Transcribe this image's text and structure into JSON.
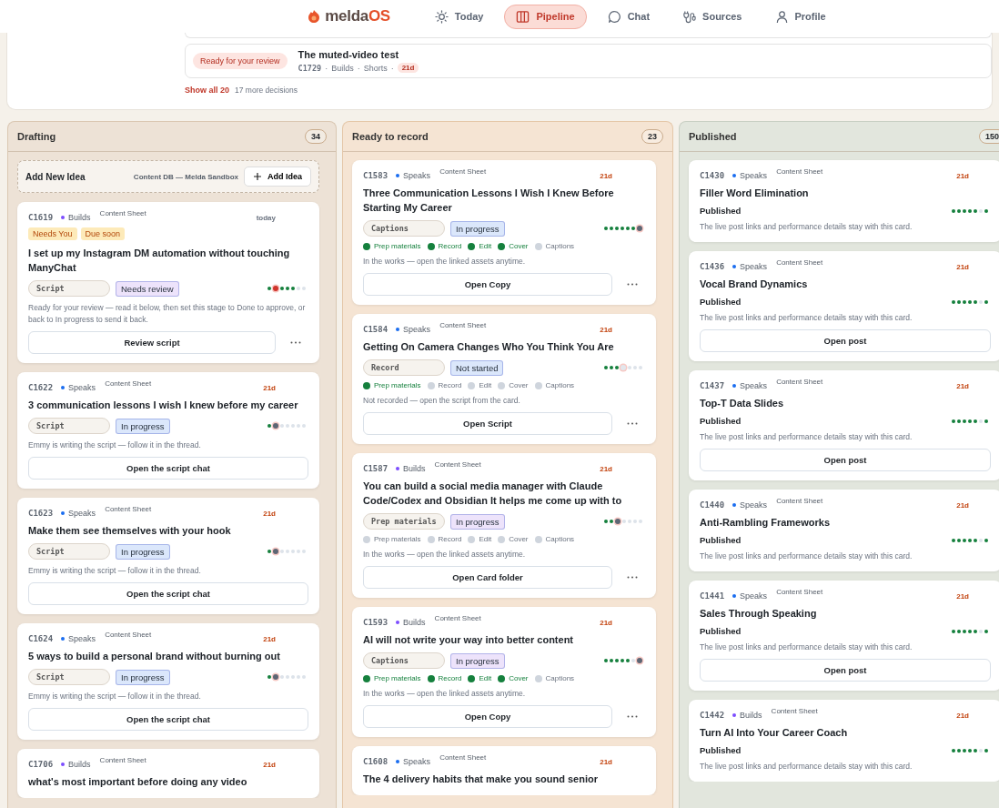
{
  "nav": {
    "logo": {
      "name": "melda",
      "suffix": "OS"
    },
    "items": [
      {
        "label": "Today",
        "selected": false
      },
      {
        "label": "Pipeline",
        "selected": true
      },
      {
        "label": "Chat",
        "selected": false
      },
      {
        "label": "Sources",
        "selected": false
      },
      {
        "label": "Profile",
        "selected": false
      }
    ]
  },
  "decisions": {
    "items": [
      {
        "badge": "Ready for your review",
        "title": "The muted-video test",
        "code": "C1729",
        "separator": "·",
        "meta": [
          "Builds",
          "Shorts"
        ],
        "age": "21d"
      }
    ],
    "show_all": "Show all 20",
    "more": "17 more decisions"
  },
  "columns": [
    {
      "title": "Drafting",
      "count": "34",
      "add_idea": {
        "title": "Add New Idea",
        "source": "Content DB — Melda Sandbox",
        "button": "Add Idea"
      },
      "cards": [
        {
          "code": "C1619",
          "category": "Builds",
          "color": "#7c4dff",
          "sheet": "Content Sheet",
          "age": "today",
          "overdue": false,
          "tags": [
            "Needs You",
            "Due soon"
          ],
          "title": "I set up my Instagram DM automation without touching ManyChat",
          "stage": "Script",
          "status": {
            "text": "Needs review",
            "color": "#ede3fb"
          },
          "dots": [
            {
              "kind": "done"
            },
            {
              "kind": "alert"
            },
            {
              "kind": "done"
            },
            {
              "kind": "done"
            },
            {
              "kind": "done"
            },
            {
              "kind": "todo"
            },
            {
              "kind": "todo"
            }
          ],
          "note": "Ready for your review — read it below, then set this stage to Done to approve, or back to In progress to send it back.",
          "action": "Review script",
          "menu": true
        },
        {
          "code": "C1622",
          "category": "Speaks",
          "color": "#1a6df0",
          "sheet": "Content Sheet",
          "age": "21d",
          "overdue": true,
          "title": "3 communication lessons I wish I knew before my career",
          "stage": "Script",
          "status": {
            "text": "In progress",
            "color": "#dbe7fb"
          },
          "dots": [
            {
              "kind": "done"
            },
            {
              "kind": "current"
            },
            {
              "kind": "todo"
            },
            {
              "kind": "todo"
            },
            {
              "kind": "todo"
            },
            {
              "kind": "todo"
            },
            {
              "kind": "todo"
            }
          ],
          "note": "Emmy is writing the script — follow it in the thread.",
          "action": "Open the script chat",
          "menu": false
        },
        {
          "code": "C1623",
          "category": "Speaks",
          "color": "#1a6df0",
          "sheet": "Content Sheet",
          "age": "21d",
          "overdue": true,
          "title": "Make them see themselves with your hook",
          "stage": "Script",
          "status": {
            "text": "In progress",
            "color": "#dbe7fb"
          },
          "dots": [
            {
              "kind": "done"
            },
            {
              "kind": "current"
            },
            {
              "kind": "todo"
            },
            {
              "kind": "todo"
            },
            {
              "kind": "todo"
            },
            {
              "kind": "todo"
            },
            {
              "kind": "todo"
            }
          ],
          "note": "Emmy is writing the script — follow it in the thread.",
          "action": "Open the script chat",
          "menu": false
        },
        {
          "code": "C1624",
          "category": "Speaks",
          "color": "#1a6df0",
          "sheet": "Content Sheet",
          "age": "21d",
          "overdue": true,
          "title": "5 ways to build a personal brand without burning out",
          "stage": "Script",
          "status": {
            "text": "In progress",
            "color": "#dbe7fb"
          },
          "dots": [
            {
              "kind": "done"
            },
            {
              "kind": "current"
            },
            {
              "kind": "todo"
            },
            {
              "kind": "todo"
            },
            {
              "kind": "todo"
            },
            {
              "kind": "todo"
            },
            {
              "kind": "todo"
            }
          ],
          "note": "Emmy is writing the script — follow it in the thread.",
          "action": "Open the script chat",
          "menu": false
        },
        {
          "code": "C1706",
          "category": "Builds",
          "color": "#7c4dff",
          "sheet": "Content Sheet",
          "age": "21d",
          "overdue": true,
          "title": "what's most important before doing any video"
        }
      ]
    },
    {
      "title": "Ready to record",
      "count": "23",
      "cards": [
        {
          "code": "C1583",
          "category": "Speaks",
          "color": "#1a6df0",
          "sheet": "Content Sheet",
          "age": "21d",
          "overdue": true,
          "title": "Three Communication Lessons I Wish I Knew Before Starting My Career",
          "stage": "Captions",
          "status": {
            "text": "In progress",
            "color": "#dbe7fb"
          },
          "dots": [
            {
              "kind": "done"
            },
            {
              "kind": "done"
            },
            {
              "kind": "done"
            },
            {
              "kind": "done"
            },
            {
              "kind": "done"
            },
            {
              "kind": "done"
            },
            {
              "kind": "current"
            }
          ],
          "checklist": [
            {
              "label": "Prep materials",
              "done": true
            },
            {
              "label": "Record",
              "done": true
            },
            {
              "label": "Edit",
              "done": true
            },
            {
              "label": "Cover",
              "done": true
            },
            {
              "label": "Captions",
              "done": false
            }
          ],
          "note": "In the works — open the linked assets anytime.",
          "action": "Open Copy",
          "menu": true
        },
        {
          "code": "C1584",
          "category": "Speaks",
          "color": "#1a6df0",
          "sheet": "Content Sheet",
          "age": "21d",
          "overdue": true,
          "title": "Getting On Camera Changes Who You Think You Are",
          "stage": "Record",
          "status": {
            "text": "Not started",
            "color": "#dbe7fb"
          },
          "dots": [
            {
              "kind": "done"
            },
            {
              "kind": "done"
            },
            {
              "kind": "done"
            },
            {
              "kind": "pending"
            },
            {
              "kind": "todo"
            },
            {
              "kind": "todo"
            },
            {
              "kind": "todo"
            }
          ],
          "checklist": [
            {
              "label": "Prep materials",
              "done": true
            },
            {
              "label": "Record",
              "done": false
            },
            {
              "label": "Edit",
              "done": false
            },
            {
              "label": "Cover",
              "done": false
            },
            {
              "label": "Captions",
              "done": false
            }
          ],
          "note": "Not recorded — open the script from the card.",
          "action": "Open Script",
          "menu": true
        },
        {
          "code": "C1587",
          "category": "Builds",
          "color": "#7c4dff",
          "sheet": "Content Sheet",
          "age": "21d",
          "overdue": true,
          "title": "You can build a social media manager with Claude Code/Codex and Obsidian It helps me come up with to",
          "stage": "Prep materials",
          "status": {
            "text": "In progress",
            "color": "#ede3fb"
          },
          "dots": [
            {
              "kind": "done"
            },
            {
              "kind": "done"
            },
            {
              "kind": "current"
            },
            {
              "kind": "todo"
            },
            {
              "kind": "todo"
            },
            {
              "kind": "todo"
            },
            {
              "kind": "todo"
            }
          ],
          "checklist": [
            {
              "label": "Prep materials",
              "done": false
            },
            {
              "label": "Record",
              "done": false
            },
            {
              "label": "Edit",
              "done": false
            },
            {
              "label": "Cover",
              "done": false
            },
            {
              "label": "Captions",
              "done": false
            }
          ],
          "note": "In the works — open the linked assets anytime.",
          "action": "Open Card folder",
          "menu": true
        },
        {
          "code": "C1593",
          "category": "Builds",
          "color": "#7c4dff",
          "sheet": "Content Sheet",
          "age": "21d",
          "overdue": true,
          "title": "AI will not write your way into better content",
          "stage": "Captions",
          "status": {
            "text": "In progress",
            "color": "#ede3fb"
          },
          "dots": [
            {
              "kind": "done"
            },
            {
              "kind": "done"
            },
            {
              "kind": "done"
            },
            {
              "kind": "done"
            },
            {
              "kind": "done"
            },
            {
              "kind": "todo"
            },
            {
              "kind": "current"
            }
          ],
          "checklist": [
            {
              "label": "Prep materials",
              "done": true
            },
            {
              "label": "Record",
              "done": true
            },
            {
              "label": "Edit",
              "done": true
            },
            {
              "label": "Cover",
              "done": true
            },
            {
              "label": "Captions",
              "done": false
            }
          ],
          "note": "In the works — open the linked assets anytime.",
          "action": "Open Copy",
          "menu": true
        },
        {
          "code": "C1608",
          "category": "Speaks",
          "color": "#1a6df0",
          "sheet": "Content Sheet",
          "age": "21d",
          "overdue": true,
          "title": "The 4 delivery habits that make you sound senior"
        }
      ]
    },
    {
      "title": "Published",
      "count": "150",
      "cards": [
        {
          "code": "C1430",
          "category": "Speaks",
          "color": "#1a6df0",
          "sheet": "Content Sheet",
          "age": "21d",
          "overdue": true,
          "title": "Filler Word Elimination",
          "status": {
            "text": "Published"
          },
          "dots": [
            {
              "kind": "done"
            },
            {
              "kind": "done"
            },
            {
              "kind": "done"
            },
            {
              "kind": "done"
            },
            {
              "kind": "done"
            },
            {
              "kind": "todo"
            },
            {
              "kind": "done"
            }
          ],
          "note": "The live post links and performance details stay with this card."
        },
        {
          "code": "C1436",
          "category": "Speaks",
          "color": "#1a6df0",
          "sheet": "Content Sheet",
          "age": "21d",
          "overdue": true,
          "title": "Vocal Brand Dynamics",
          "status": {
            "text": "Published"
          },
          "dots": [
            {
              "kind": "done"
            },
            {
              "kind": "done"
            },
            {
              "kind": "done"
            },
            {
              "kind": "done"
            },
            {
              "kind": "done"
            },
            {
              "kind": "todo"
            },
            {
              "kind": "done"
            }
          ],
          "note": "The live post links and performance details stay with this card.",
          "action": "Open post",
          "menu": false
        },
        {
          "code": "C1437",
          "category": "Speaks",
          "color": "#1a6df0",
          "sheet": "Content Sheet",
          "age": "21d",
          "overdue": true,
          "title": "Top-T Data Slides",
          "status": {
            "text": "Published"
          },
          "dots": [
            {
              "kind": "done"
            },
            {
              "kind": "done"
            },
            {
              "kind": "done"
            },
            {
              "kind": "done"
            },
            {
              "kind": "done"
            },
            {
              "kind": "todo"
            },
            {
              "kind": "done"
            }
          ],
          "note": "The live post links and performance details stay with this card.",
          "action": "Open post",
          "menu": false
        },
        {
          "code": "C1440",
          "category": "Speaks",
          "color": "#1a6df0",
          "sheet": "Content Sheet",
          "age": "21d",
          "overdue": true,
          "title": "Anti-Rambling Frameworks",
          "status": {
            "text": "Published"
          },
          "dots": [
            {
              "kind": "done"
            },
            {
              "kind": "done"
            },
            {
              "kind": "done"
            },
            {
              "kind": "done"
            },
            {
              "kind": "done"
            },
            {
              "kind": "todo"
            },
            {
              "kind": "done"
            }
          ],
          "note": "The live post links and performance details stay with this card."
        },
        {
          "code": "C1441",
          "category": "Speaks",
          "color": "#1a6df0",
          "sheet": "Content Sheet",
          "age": "21d",
          "overdue": true,
          "title": "Sales Through Speaking",
          "status": {
            "text": "Published"
          },
          "dots": [
            {
              "kind": "done"
            },
            {
              "kind": "done"
            },
            {
              "kind": "done"
            },
            {
              "kind": "done"
            },
            {
              "kind": "done"
            },
            {
              "kind": "todo"
            },
            {
              "kind": "done"
            }
          ],
          "note": "The live post links and performance details stay with this card.",
          "action": "Open post",
          "menu": false
        },
        {
          "code": "C1442",
          "category": "Builds",
          "color": "#7c4dff",
          "sheet": "Content Sheet",
          "age": "21d",
          "overdue": true,
          "title": "Turn AI Into Your Career Coach",
          "status": {
            "text": "Published"
          },
          "dots": [
            {
              "kind": "done"
            },
            {
              "kind": "done"
            },
            {
              "kind": "done"
            },
            {
              "kind": "done"
            },
            {
              "kind": "done"
            },
            {
              "kind": "todo"
            },
            {
              "kind": "done"
            }
          ],
          "note": "The live post links and performance details stay with this card."
        }
      ]
    }
  ]
}
